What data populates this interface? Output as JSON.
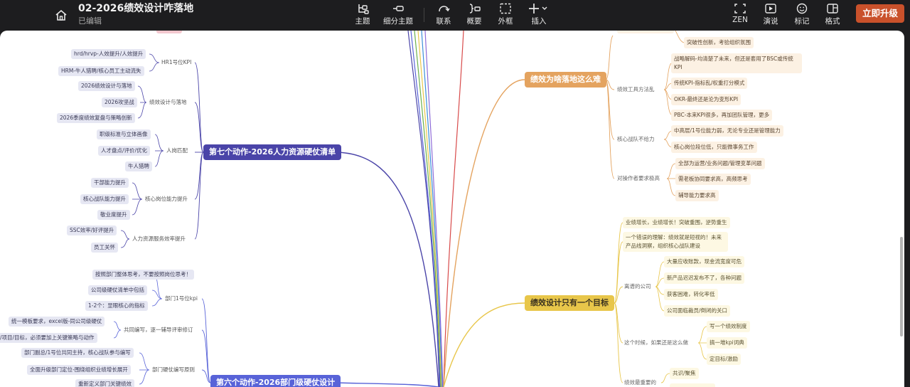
{
  "header": {
    "title": "02-2026绩效设计咋落地",
    "status": "已编辑"
  },
  "toolbar": {
    "topic": "主题",
    "subtopic": "细分主题",
    "relation": "联系",
    "summary": "概要",
    "boundary": "外框",
    "insert": "插入",
    "zen": "ZEN",
    "present": "演说",
    "marker": "标记",
    "format": "格式",
    "upgrade": "立即升级"
  },
  "left": {
    "branch7": {
      "title": "第七个动作-2026人力资源硬仗清单",
      "groups": [
        {
          "label": "HR1号位KPI",
          "items": [
            "hrd/hrvp-人效提升/人效提升",
            "HRM-牛人猎聘/核心员工主动流失"
          ]
        },
        {
          "label": "绩效设计与落地",
          "items": [
            "2026绩效设计与落地",
            "2026攻坚战",
            "2026季度绩效复盘与策略创新"
          ]
        },
        {
          "label": "人岗匹配",
          "items": [
            "职级标准与立体画像",
            "人才盘点/评价/优化",
            "牛人猎聘"
          ]
        },
        {
          "label": "核心岗位能力提升",
          "items": [
            "干部能力提升",
            "核心战队能力提升",
            "敬业度提升"
          ]
        },
        {
          "label": "人力资源服务效率提升",
          "items": [
            "SSC效率/好评提升",
            "员工关怀"
          ]
        }
      ]
    },
    "branch6": {
      "title": "第六个动作-2026部门级硬仗设计",
      "groups": [
        {
          "label": "部门1号位kpi",
          "items": [
            "按照部门整体思考，不要按照岗位思考！",
            "公司级硬仗清单中包括",
            "1-2个：显眼核心的指标"
          ]
        },
        {
          "label": "共同编写，逐一辅导评审修订",
          "items": [
            "统一模板要求，excel版-同公司级硬仗",
            "/项目/目标，必须要加上关键策略与动作"
          ]
        },
        {
          "label": "部门硬仗编写原则",
          "items": [
            "部门副总/1号位共同主持，核心战队参与编写",
            "全面升级部门定位-围绕组织业绩增长展开",
            "重新定义部门关键绩效"
          ]
        }
      ]
    }
  },
  "right": {
    "branch_hard": {
      "title": "绩效为啥落地这么难",
      "top_item": "突破性创新，考验组织氛围",
      "groups": [
        {
          "label": "绩效工具方法乱",
          "items": [
            "战略解码-均清楚了未来，但还是套用了BSC或传统KPI",
            "传统KPI-指标乱/权重打分模式",
            "OKR-最终还是沦为变形KPI",
            "PBC-本来KPI很多，再加团队管理，更多"
          ]
        },
        {
          "label": "核心战队不给力",
          "items": [
            "中高层/1号位能力弱，无论专业还是管理能力",
            "核心岗位段位低，只能微事务工作"
          ]
        },
        {
          "label": "对操作者要求极高",
          "items": [
            "全部为运营/业务问题/管理变革问题",
            "需老板协同要求高，高频思考",
            "辅导能力要求高"
          ]
        }
      ]
    },
    "branch_goal": {
      "title": "绩效设计只有一个目标",
      "items": [
        "业绩增长，业绩增长！突破重围，逆势重生",
        "一个错误的理解：绩效就是短视的！未来产品线洞察，组织核心战队建设"
      ],
      "groups": [
        {
          "label": "离谱的公司",
          "items": [
            "大量应收账款，现金流宽度可危",
            "新产品迟迟发布不了，各种问题",
            "获客困难，转化率低",
            "公司面临裁员/倒闭的关口"
          ]
        },
        {
          "label": "这个时候，如果还是这么做",
          "items": [
            "写一个绩效制度",
            "搞一堆kpi词典",
            "定目标/激励"
          ]
        },
        {
          "label": "绩效最重要的",
          "items": [
            "共识/聚焦"
          ]
        }
      ]
    }
  },
  "colors": {
    "branch7": "#4a44a8",
    "branch6": "#5863d8",
    "orange": "#e4a35f",
    "yellow": "#e8c64a",
    "upgrade": "#c9512b"
  }
}
